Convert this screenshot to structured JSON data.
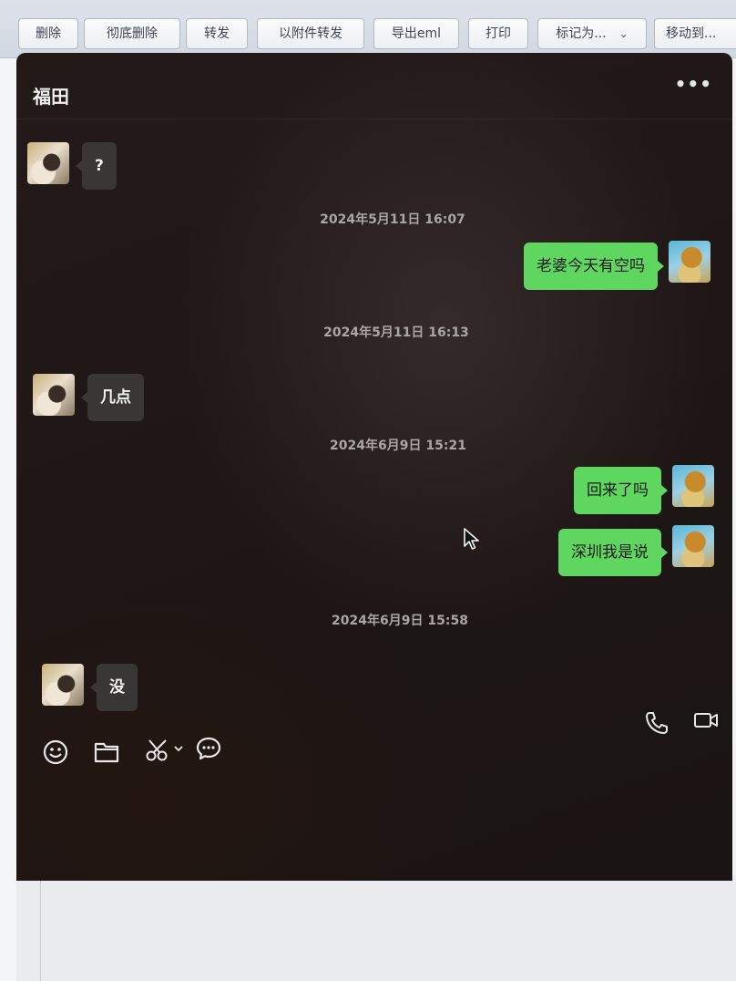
{
  "toolbar": {
    "buttons": [
      "删除",
      "彻底删除",
      "转发",
      "以附件转发",
      "导出eml",
      "打印",
      "标记为...",
      "移动到..."
    ]
  },
  "chat": {
    "title": "福田",
    "more": "•••",
    "messages": [
      {
        "type": "msg",
        "side": "other",
        "text": "?"
      },
      {
        "type": "time",
        "text": "2024年5月11日 16:07"
      },
      {
        "type": "msg",
        "side": "me",
        "text": "老婆今天有空吗"
      },
      {
        "type": "time",
        "text": "2024年5月11日 16:13"
      },
      {
        "type": "msg",
        "side": "other",
        "text": "几点"
      },
      {
        "type": "time",
        "text": "2024年6月9日 15:21"
      },
      {
        "type": "msg",
        "side": "me",
        "text": "回来了吗"
      },
      {
        "type": "msg",
        "side": "me",
        "text": "深圳我是说"
      },
      {
        "type": "time",
        "text": "2024年6月9日 15:58"
      },
      {
        "type": "msg",
        "side": "other",
        "text": "没"
      }
    ]
  },
  "colors": {
    "bubble_me": "#5fd660",
    "bubble_other": "#3a3634",
    "chat_bg": "#1f1816"
  },
  "icons": {
    "input_toolbar": [
      "emoji-icon",
      "folder-icon",
      "scissors-icon",
      "chevron-down-icon",
      "chat-history-icon"
    ],
    "call_buttons": [
      "phone-icon",
      "video-camera-icon"
    ]
  }
}
